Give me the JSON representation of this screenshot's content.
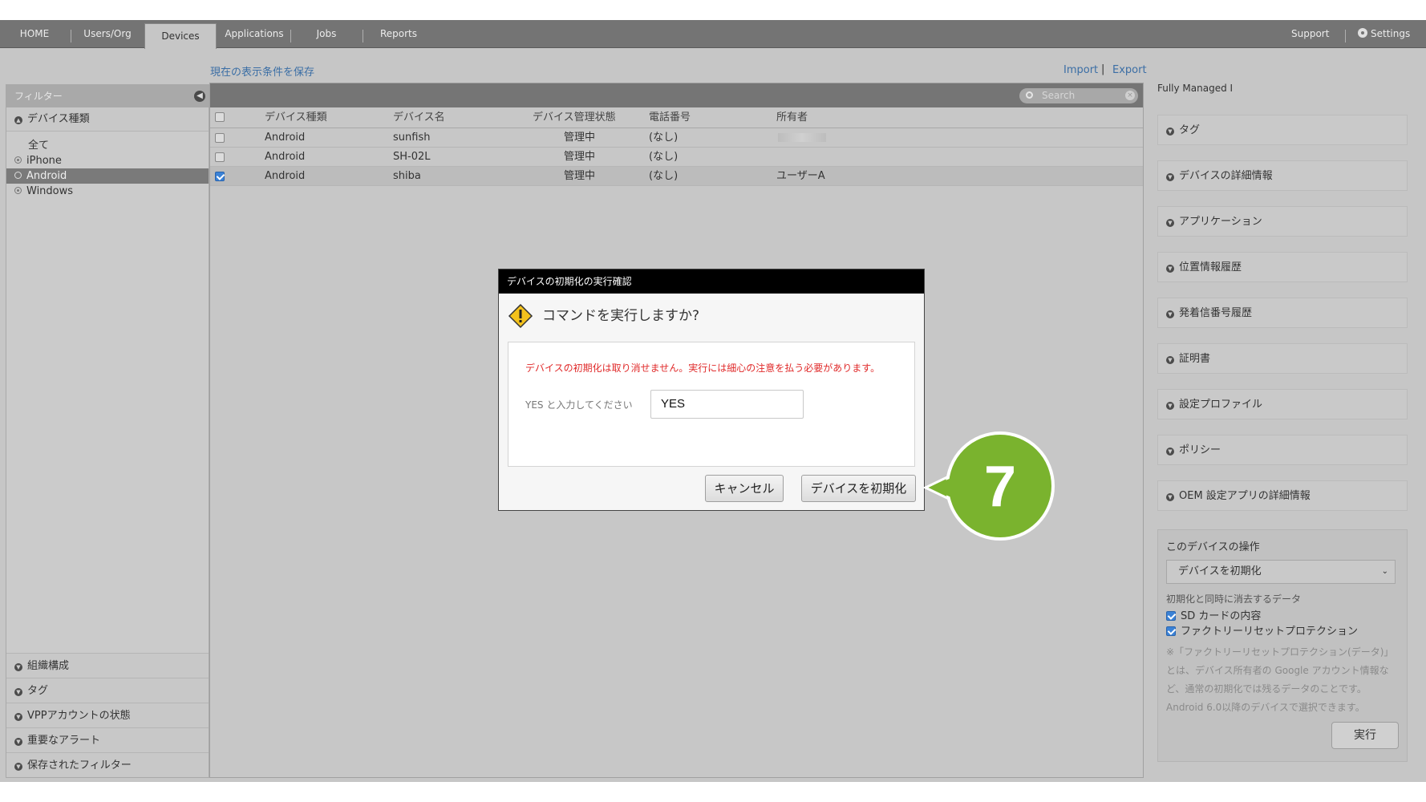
{
  "nav": {
    "tabs": [
      {
        "label": "HOME"
      },
      {
        "label": "Users/Org"
      },
      {
        "label": "Devices"
      },
      {
        "label": "Applications"
      },
      {
        "label": "Jobs"
      },
      {
        "label": "Reports"
      }
    ],
    "support": "Support",
    "settings": "Settings"
  },
  "links": {
    "save_view": "現在の表示条件を保存",
    "import": "Import",
    "separator": "|",
    "export": "Export"
  },
  "filter": {
    "header": "フィルター",
    "device_type_title": "デバイス種類",
    "items": [
      {
        "label": "全て",
        "selected": false,
        "radio": false
      },
      {
        "label": "iPhone",
        "selected": false,
        "radio": true
      },
      {
        "label": "Android",
        "selected": true,
        "radio": true
      },
      {
        "label": "Windows",
        "selected": false,
        "radio": true
      }
    ],
    "bottom_sections": [
      "組織構成",
      "タグ",
      "VPPアカウントの状態",
      "重要なアラート",
      "保存されたフィルター"
    ]
  },
  "search": {
    "placeholder": "Search"
  },
  "table": {
    "columns": [
      "デバイス種類",
      "デバイス名",
      "デバイス管理状態",
      "電話番号",
      "所有者"
    ],
    "rows": [
      {
        "checked": false,
        "type": "Android",
        "name": "sunfish",
        "status": "管理中",
        "phone": "(なし)",
        "owner": ""
      },
      {
        "checked": false,
        "type": "Android",
        "name": "SH-02L",
        "status": "管理中",
        "phone": "(なし)",
        "owner": ""
      },
      {
        "checked": true,
        "type": "Android",
        "name": "shiba",
        "status": "管理中",
        "phone": "(なし)",
        "owner": "ユーザーA"
      }
    ]
  },
  "right": {
    "title": "Fully Managed I",
    "sections": [
      "タグ",
      "デバイスの詳細情報",
      "アプリケーション",
      "位置情報履歴",
      "発着信番号履歴",
      "証明書",
      "設定プロファイル",
      "ポリシー",
      "OEM 設定アプリの詳細情報"
    ],
    "ops": {
      "title": "このデバイスの操作",
      "selected_action": "デバイスを初期化",
      "erase_label": "初期化と同時に消去するデータ",
      "checks": [
        "SD カードの内容",
        "ファクトリーリセットプロテクション"
      ],
      "note": "※「ファクトリーリセットプロテクション(データ)」とは、デバイス所有者の Google アカウント情報など、通常の初期化では残るデータのことです。Android 6.0以降のデバイスで選択できます。",
      "run_label": "実行"
    }
  },
  "dialog": {
    "title": "デバイスの初期化の実行確認",
    "question": "コマンドを実行しますか?",
    "warning": "デバイスの初期化は取り消せません。実行には細心の注意を払う必要があります。",
    "input_label": "YES と入力してください",
    "input_value": "YES",
    "cancel": "キャンセル",
    "confirm": "デバイスを初期化"
  },
  "callout": {
    "number": "7",
    "color": "#7ab32e"
  }
}
